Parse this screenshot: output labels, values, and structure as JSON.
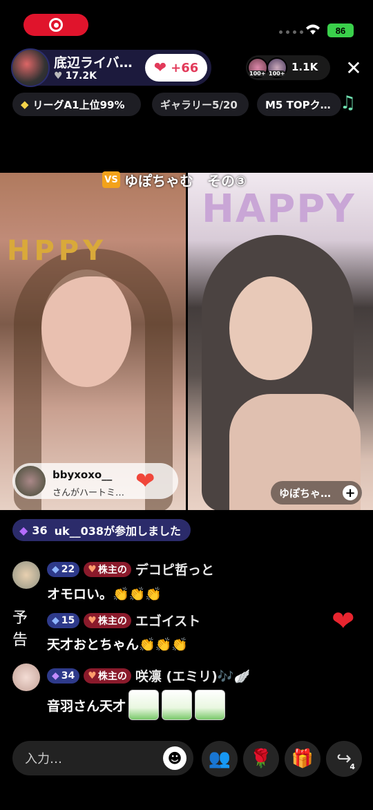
{
  "status_bar": {
    "battery": "86"
  },
  "host": {
    "name": "底辺ライバ…",
    "followers": "17.2K",
    "heart_count": "+66"
  },
  "viewers": {
    "count": "1.1K",
    "badge1": "100+",
    "badge2": "100+"
  },
  "chips": [
    {
      "label": "リーグA1上位99%"
    },
    {
      "label": "ギャラリー5/20"
    },
    {
      "label": "M5 TOPク…"
    }
  ],
  "versus": {
    "badge": "VS",
    "title": "ゆぽちゃむ　その③"
  },
  "left_stream": {
    "user": "bbyxoxo__",
    "sub": "さんがハートミ…"
  },
  "right_stream": {
    "user": "ゆぽちゃ…"
  },
  "chat": {
    "join": {
      "level": "36",
      "text": "uk__038が参加しました"
    },
    "messages": [
      {
        "level": "22",
        "badge": "株主の",
        "user": "デコピ哲っと",
        "text": "オモロい。👏👏👏"
      },
      {
        "level": "15",
        "badge": "株主の",
        "user": "エゴイスト",
        "text": "天才おとちゃん👏👏👏"
      },
      {
        "level": "34",
        "badge": "株主の",
        "user": "咲凛 (エミリ)🎶🪽",
        "text": "音羽さん天才"
      }
    ]
  },
  "bottom": {
    "input_placeholder": "入力…",
    "share_count": "4"
  },
  "colors": {
    "accent": "#e0142c",
    "battery": "#3ad04b",
    "level_badge": "#2e3a8a",
    "kabu_badge": "#8a1a2b"
  }
}
